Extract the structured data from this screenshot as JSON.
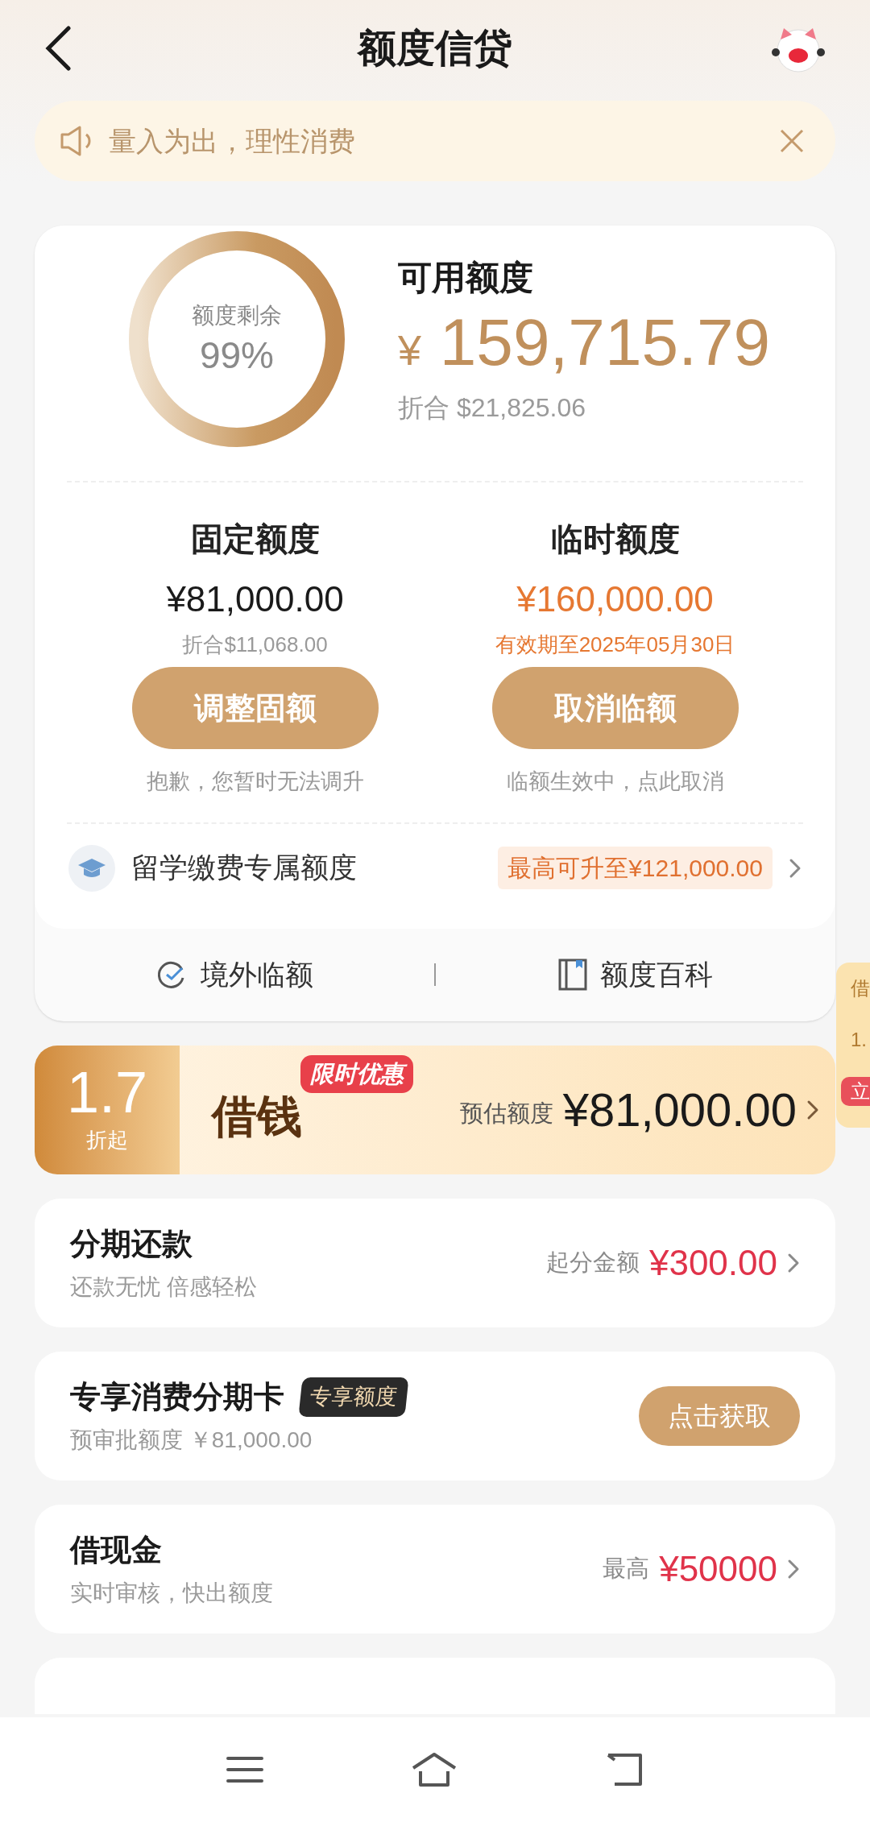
{
  "header": {
    "title": "额度信贷"
  },
  "notice": {
    "text": "量入为出，理性消费"
  },
  "credit": {
    "ring_label": "额度剩余",
    "ring_value": "99%",
    "title": "可用额度",
    "currency": "¥",
    "amount": "159,715.79",
    "converted_label": "折合",
    "converted": "$21,825.06",
    "columns": [
      {
        "kind": "fixed",
        "title": "固定额度",
        "amount": "¥81,000.00",
        "sub": "折合$11,068.00",
        "button": "调整固额",
        "note": "抱歉，您暂时无法调升"
      },
      {
        "kind": "temporary",
        "title": "临时额度",
        "amount": "¥160,000.00",
        "sub": "有效期至2025年05月30日",
        "button": "取消临额",
        "note": "临额生效中，点此取消"
      }
    ],
    "study": {
      "label": "留学缴费专属额度",
      "badge": "最高可升至¥121,000.00"
    },
    "links": [
      {
        "kind": "overseas",
        "label": "境外临额"
      },
      {
        "kind": "wiki",
        "label": "额度百科"
      }
    ]
  },
  "loan_banner": {
    "discount": "1.7",
    "discount_suffix": "折起",
    "title": "借钱",
    "tag": "限时优惠",
    "estimate_label": "预估额度",
    "estimate": "¥81,000.00"
  },
  "products": [
    {
      "kind": "amount",
      "title": "分期还款",
      "subtitle": "还款无忧 倍感轻松",
      "label": "起分金额",
      "value": "¥300.00"
    },
    {
      "kind": "button",
      "title": "专享消费分期卡",
      "tag": "专享额度",
      "subtitle": "预审批额度 ￥81,000.00",
      "button": "点击获取"
    },
    {
      "kind": "amount",
      "title": "借现金",
      "subtitle": "实时审核，快出额度",
      "label": "最高",
      "value": "¥50000"
    },
    {
      "kind": "cut"
    }
  ],
  "side_widget": {
    "lines": [
      "借",
      "1.",
      "立"
    ]
  }
}
